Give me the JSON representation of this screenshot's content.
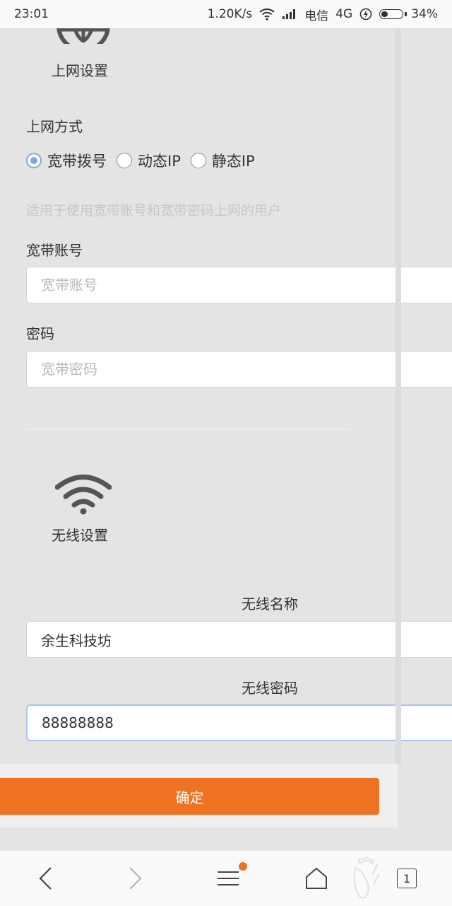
{
  "status_bar": {
    "time": "23:01",
    "speed": "1.20K/s",
    "carrier": "电信",
    "network": "4G",
    "battery": "34%"
  },
  "internet_section": {
    "title": "上网设置",
    "method_label": "上网方式",
    "options": [
      "宽带拨号",
      "动态IP",
      "静态IP"
    ],
    "selected_option": "宽带拨号",
    "hint": "适用于使用宽带账号和宽带密码上网的用户",
    "account_label": "宽带账号",
    "account_placeholder": "宽带账号",
    "password_label": "密码",
    "password_placeholder": "宽带密码"
  },
  "wireless_section": {
    "title": "无线设置",
    "ssid_label": "无线名称",
    "ssid_value": "余生科技坊",
    "password_label": "无线密码",
    "password_value": "88888888"
  },
  "actions": {
    "confirm_label": "确定"
  },
  "browser_nav": {
    "tab_count": "1"
  },
  "colors": {
    "accent": "#ee7222",
    "radio_selected": "#7fa8da",
    "background": "#e4e4e4"
  }
}
